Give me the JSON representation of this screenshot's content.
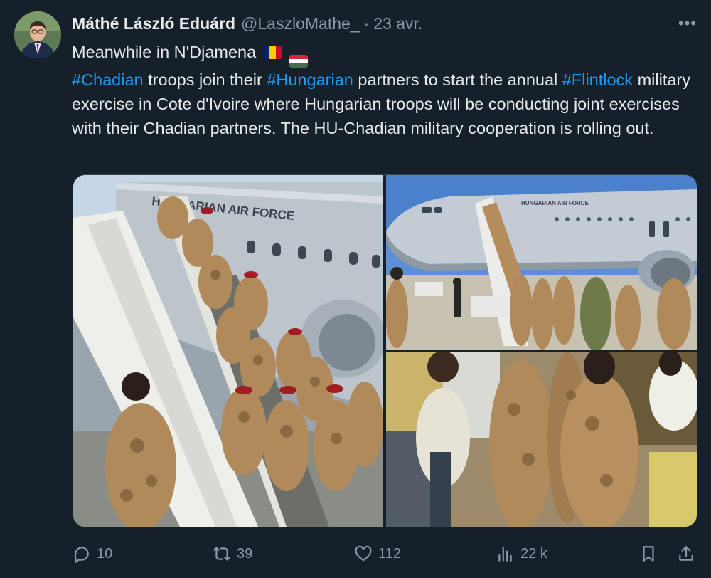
{
  "tweet": {
    "author_name": "Máthé László Eduárd",
    "handle": "@LaszloMathe_",
    "separator": "·",
    "date": "23 avr.",
    "more_label": "•••",
    "text": {
      "line1": "Meanwhile in N'Djamena",
      "hashtag1": "#Chadian",
      "seg1": " troops join their ",
      "hashtag2": "#Hungarian",
      "seg2": " partners to start the annual ",
      "hashtag3": "#Flintlock",
      "seg3": " military exercise in Cote d'Ivoire where Hungarian troops will be conducting joint exercises with their Chadian partners. The HU-Chadian military cooperation is rolling out."
    },
    "media": {
      "photo1_aircraft_text": "HUNGARIAN AIR FORCE",
      "photo2_aircraft_text": "HUNGARIAN AIR FORCE"
    }
  },
  "actions": {
    "reply_count": "10",
    "retweet_count": "39",
    "like_count": "112",
    "views_count": "22 k"
  },
  "icons": [
    "reply-icon",
    "retweet-icon",
    "like-icon",
    "views-icon",
    "bookmark-icon",
    "share-icon"
  ],
  "colors": {
    "background": "#15202b",
    "text": "#e7e9ea",
    "secondary": "#8b98a5",
    "hashtag": "#1d9bf0"
  }
}
